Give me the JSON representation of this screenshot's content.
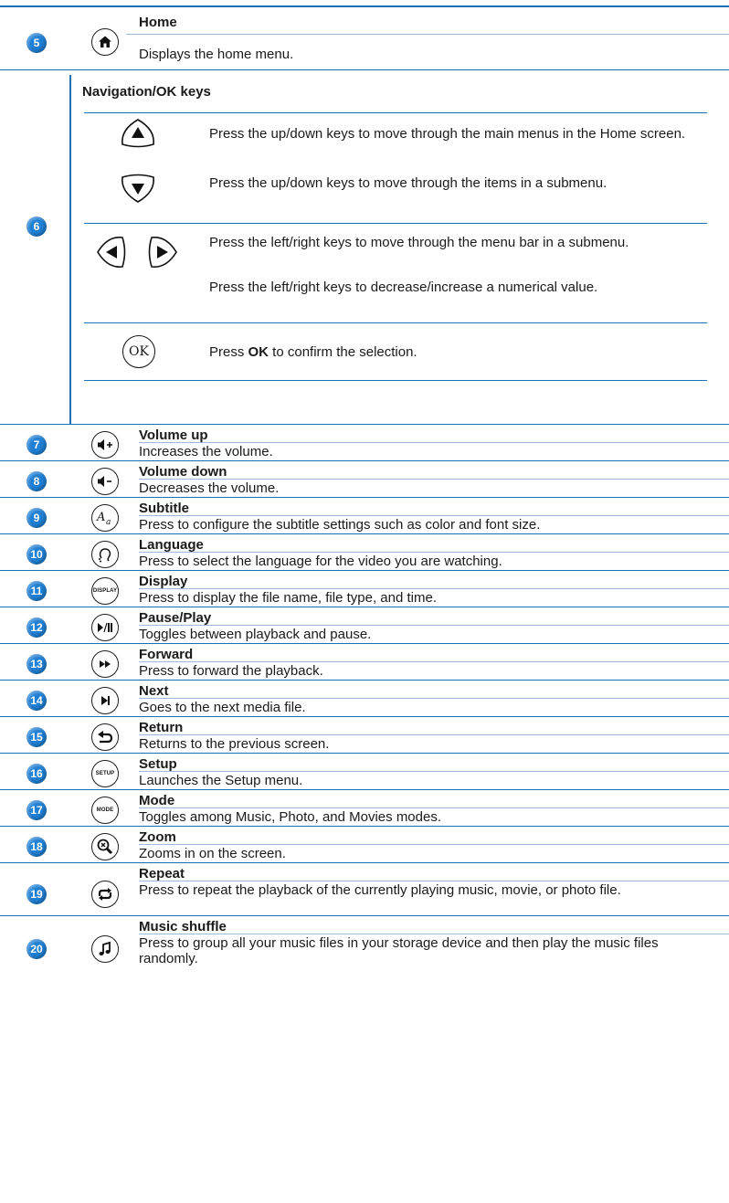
{
  "home": {
    "number": "5",
    "title": "Home",
    "desc": "Displays the home menu.",
    "icon": "home-icon"
  },
  "nav": {
    "number": "6",
    "title": "Navigation/OK keys",
    "updown_desc_1": "Press the up/down keys to move through the main menus in the Home screen.",
    "updown_desc_2": "Press the up/down keys to move through the items in a submenu.",
    "leftright_desc_1": "Press the left/right keys to move through the menu bar in a submenu.",
    "leftright_desc_2": "Press the left/right keys to decrease/increase a numerical value.",
    "ok_label": "OK",
    "ok_desc_prefix": "Press ",
    "ok_desc_bold": "OK",
    "ok_desc_suffix": " to confirm the selection."
  },
  "items": [
    {
      "number": "7",
      "title": "Volume up",
      "desc": "Increases the volume.",
      "icon": "volume-up-icon"
    },
    {
      "number": "8",
      "title": "Volume down",
      "desc": "Decreases the volume.",
      "icon": "volume-down-icon"
    },
    {
      "number": "9",
      "title": "Subtitle",
      "desc": "Press to configure the subtitle settings such as color and font size.",
      "icon": "subtitle-icon"
    },
    {
      "number": "10",
      "title": "Language",
      "desc": "Press to select the language for the video you are watching.",
      "icon": "language-icon"
    },
    {
      "number": "11",
      "title": "Display",
      "desc": "Press to display the file name, file type, and time.",
      "icon": "display-icon",
      "icon_text": "DISPLAY"
    },
    {
      "number": "12",
      "title": "Pause/Play",
      "desc": "Toggles between playback and pause.",
      "icon": "pause-play-icon"
    },
    {
      "number": "13",
      "title": "Forward",
      "desc": "Press to forward the playback.",
      "icon": "forward-icon"
    },
    {
      "number": "14",
      "title": "Next",
      "desc": "Goes to the next media file.",
      "icon": "next-icon"
    },
    {
      "number": "15",
      "title": "Return",
      "desc": "Returns to the previous screen.",
      "icon": "return-icon"
    },
    {
      "number": "16",
      "title": "Setup",
      "desc": "Launches the Setup menu.",
      "icon": "setup-icon",
      "icon_text": "SETUP"
    },
    {
      "number": "17",
      "title": "Mode",
      "desc": "Toggles among Music, Photo, and Movies modes.",
      "icon": "mode-icon",
      "icon_text": "MODE"
    },
    {
      "number": "18",
      "title": "Zoom",
      "desc": "Zooms in on the screen.",
      "icon": "zoom-icon"
    },
    {
      "number": "19",
      "title": "Repeat",
      "desc": "Press to repeat the playback of the currently playing music, movie, or photo file.",
      "icon": "repeat-icon"
    },
    {
      "number": "20",
      "title": "Music shuffle",
      "desc": "Press to group all your music files in your storage device and then play the music files randomly.",
      "icon": "music-shuffle-icon"
    }
  ],
  "colors": {
    "accent": "#1f6fb5",
    "badge": "#1f7fd4"
  }
}
